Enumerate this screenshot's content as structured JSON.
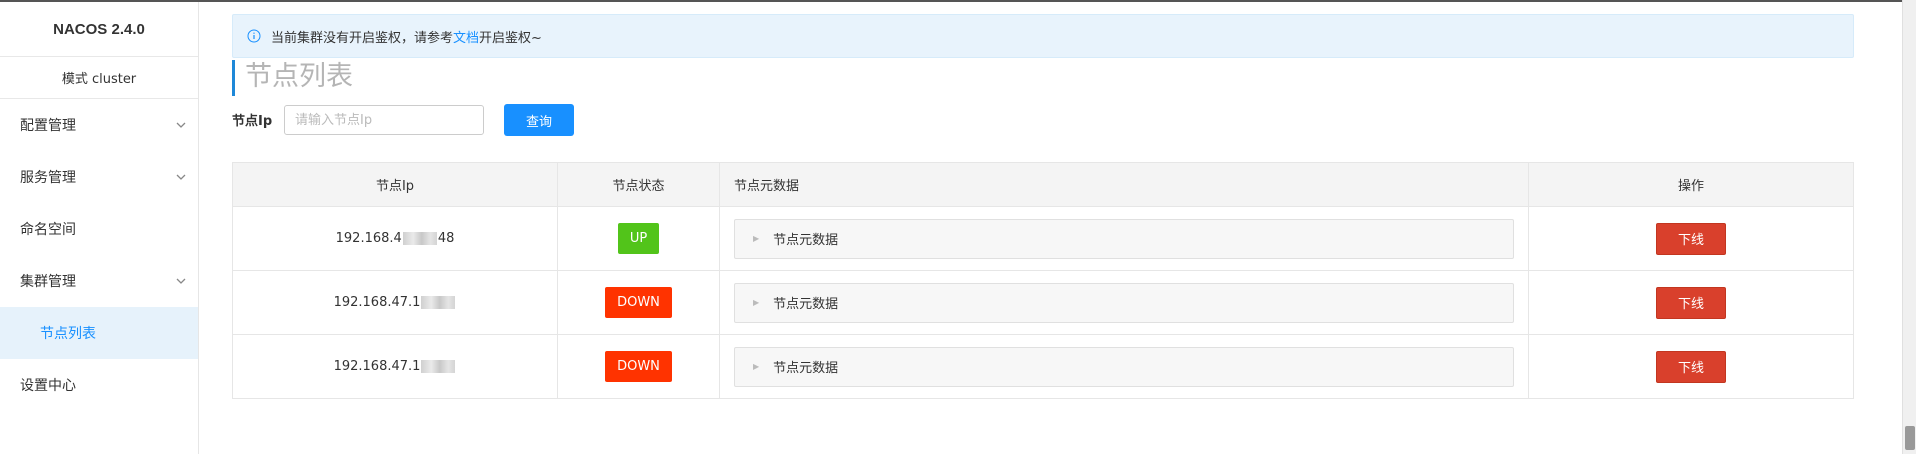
{
  "sidebar": {
    "brand": "NACOS 2.4.0",
    "mode": "模式 cluster",
    "items": [
      {
        "label": "配置管理"
      },
      {
        "label": "服务管理"
      },
      {
        "label": "命名空间"
      },
      {
        "label": "集群管理"
      },
      {
        "label": "节点列表"
      },
      {
        "label": "设置中心"
      }
    ]
  },
  "alert": {
    "text_before": "当前集群没有开启鉴权，请参考",
    "link": "文档",
    "text_after": "开启鉴权~"
  },
  "page_title": "节点列表",
  "search": {
    "label": "节点Ip",
    "placeholder": "请输入节点Ip",
    "button": "查询"
  },
  "table": {
    "headers": {
      "ip": "节点Ip",
      "status": "节点状态",
      "meta": "节点元数据",
      "action": "操作"
    },
    "rows": [
      {
        "ip_prefix": "192.168.4",
        "ip_suffix": "48",
        "status": "UP",
        "meta": "节点元数据",
        "action": "下线"
      },
      {
        "ip_prefix": "192.168.47.1",
        "ip_suffix": "",
        "status": "DOWN",
        "meta": "节点元数据",
        "action": "下线"
      },
      {
        "ip_prefix": "192.168.47.1",
        "ip_suffix": "",
        "status": "DOWN",
        "meta": "节点元数据",
        "action": "下线"
      }
    ]
  },
  "colors": {
    "primary": "#1890ff",
    "up": "#52c41a",
    "down": "#ff3300",
    "offline": "#d9402c"
  }
}
